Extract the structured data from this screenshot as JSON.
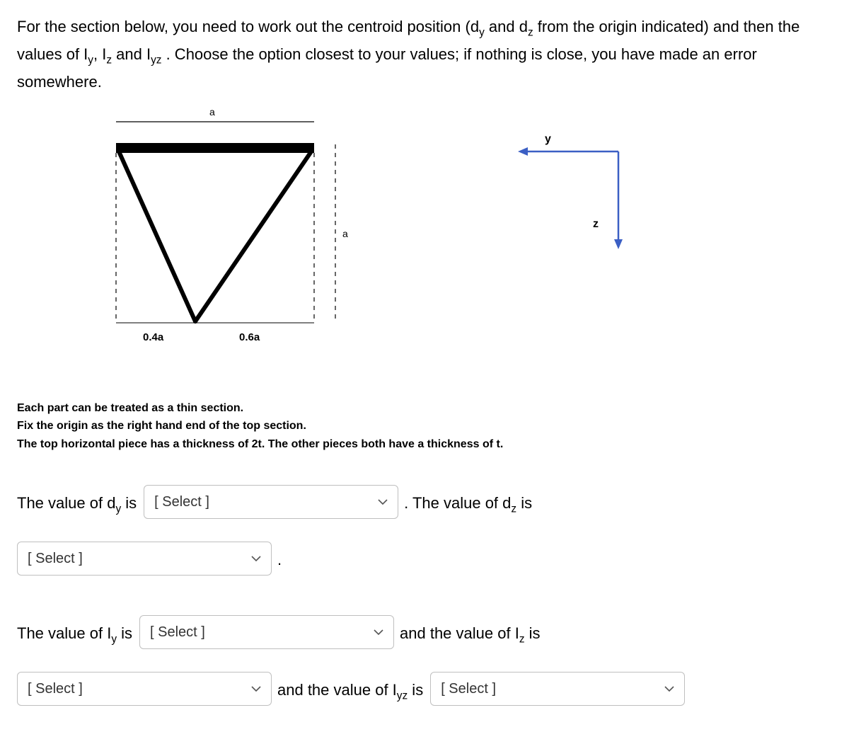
{
  "intro": {
    "part1": "For the section below, you need to work out the centroid position (d",
    "sub_y": "y",
    "part2": " and d",
    "sub_z": "z",
    "part3": " from the origin indicated) and then the values of I",
    "part4": ", I",
    "part5": " and I",
    "sub_yz": "yz",
    "part6": " .  Choose the option closest to your values; if nothing is close, you have made an error somewhere."
  },
  "diagram": {
    "top_dim": "a",
    "right_dim": "a",
    "left_bottom": "0.4a",
    "right_bottom": "0.6a"
  },
  "axes": {
    "y_label": "y",
    "z_label": "z"
  },
  "notes": {
    "line1": "Each part can be treated as a thin section.",
    "line2": "Fix the origin as the right hand end of the top section.",
    "line3": "The top horizontal piece has a thickness of 2t. The other pieces both have a thickness of t."
  },
  "answers": {
    "dy_label_pre": "The value of d",
    "dy_label_post": " is",
    "dz_label_pre": ". The value of d",
    "dz_label_post": " is",
    "iy_label_pre": "The value of I",
    "iy_label_post": " is",
    "iz_label_pre": " and the value of I",
    "iz_label_post": " is",
    "iyz_label_pre": " and the value of I",
    "iyz_label_post": " is",
    "select_placeholder": "[ Select ]",
    "period": "."
  }
}
